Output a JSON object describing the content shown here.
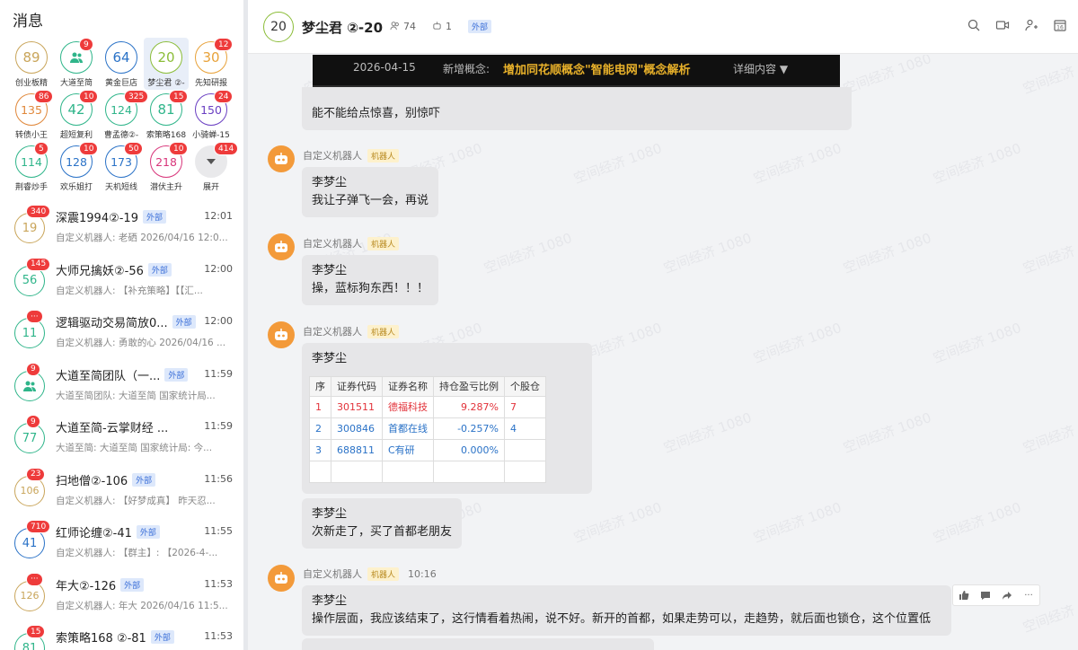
{
  "sidebar": {
    "title": "消息",
    "grid": [
      {
        "num": "89",
        "label": "创业板精",
        "badge": "",
        "color": "#c9a55a",
        "selected": false
      },
      {
        "num": "",
        "label": "大道至简",
        "badge": "9",
        "color": "#2fb58a",
        "selected": false,
        "icon": "people-icon"
      },
      {
        "num": "64",
        "label": "黄金巨店",
        "badge": "",
        "color": "#2a72c7",
        "selected": false
      },
      {
        "num": "20",
        "label": "梦尘君 ②-",
        "badge": "",
        "color": "#8bbd38",
        "selected": true
      },
      {
        "num": "30",
        "label": "先知研报",
        "badge": "12",
        "color": "#e8a23a",
        "selected": false
      },
      {
        "num": "135",
        "label": "转债小王",
        "badge": "86",
        "color": "#e0873a",
        "selected": false
      },
      {
        "num": "42",
        "label": "超短复利",
        "badge": "10",
        "color": "#2fb58a",
        "selected": false
      },
      {
        "num": "124",
        "label": "曹孟德②-",
        "badge": "325",
        "color": "#2fb58a",
        "selected": false
      },
      {
        "num": "81",
        "label": "索策略168",
        "badge": "15",
        "color": "#2fb58a",
        "selected": false
      },
      {
        "num": "150",
        "label": "小骑蝉-15",
        "badge": "24",
        "color": "#6a3fc2",
        "selected": false
      },
      {
        "num": "114",
        "label": "荆睿炒手",
        "badge": "5",
        "color": "#2fb58a",
        "selected": false
      },
      {
        "num": "128",
        "label": "欢乐姐打",
        "badge": "10",
        "color": "#2a72c7",
        "selected": false
      },
      {
        "num": "173",
        "label": "天机短线",
        "badge": "50",
        "color": "#2a72c7",
        "selected": false
      },
      {
        "num": "218",
        "label": "潜伏主升",
        "badge": "10",
        "color": "#d8357a",
        "selected": false
      },
      {
        "num": "",
        "label": "展开",
        "badge": "414",
        "color": "#e5e5e5",
        "selected": false,
        "icon": "expand-down-icon"
      }
    ],
    "conversations": [
      {
        "avatar": "19",
        "color": "#c9a55a",
        "badge": "340",
        "name": "深震1994②-19",
        "ext": "外部",
        "time": "12:01",
        "preview": "自定义机器人: 老硒 2026/04/16 12:0..."
      },
      {
        "avatar": "56",
        "color": "#2fb58a",
        "badge": "145",
        "name": "大师兄擒妖②-56",
        "ext": "外部",
        "time": "12:00",
        "preview": "自定义机器人: 【补充策略】【【汇..."
      },
      {
        "avatar": "11",
        "color": "#2fb58a",
        "badge": "···",
        "name": "逻辑驱动交易简放0...",
        "ext": "外部",
        "time": "12:00",
        "preview": "自定义机器人: 勇敢的心 2026/04/16 ..."
      },
      {
        "avatar": "",
        "color": "#2fb58a",
        "badge": "9",
        "name": "大道至简团队（一...",
        "ext": "外部",
        "time": "11:59",
        "preview": "大道至简团队: 大道至简 国家统计局...",
        "icon": "people-icon"
      },
      {
        "avatar": "77",
        "color": "#2fb58a",
        "badge": "9",
        "name": "大道至简-云掌财经 ...",
        "ext": "",
        "time": "11:59",
        "preview": "大道至简: 大道至简 国家统计局: 今..."
      },
      {
        "avatar": "106",
        "color": "#c9a55a",
        "badge": "23",
        "name": "扫地僧②-106",
        "ext": "外部",
        "time": "11:56",
        "preview": "自定义机器人: 【好梦成真】 昨天忍..."
      },
      {
        "avatar": "41",
        "color": "#2a72c7",
        "badge": "710",
        "name": "红师论缠②-41",
        "ext": "外部",
        "time": "11:55",
        "preview": "自定义机器人: 【群主】: 【2026-4-..."
      },
      {
        "avatar": "126",
        "color": "#c9a55a",
        "badge": "···",
        "name": "年大②-126",
        "ext": "外部",
        "time": "11:53",
        "preview": "自定义机器人: 年大 2026/04/16 11:5..."
      },
      {
        "avatar": "81",
        "color": "#2fb58a",
        "badge": "15",
        "name": "索策略168 ②-81",
        "ext": "外部",
        "time": "11:53",
        "preview": ""
      }
    ]
  },
  "header": {
    "avatar": "20",
    "title": "梦尘君 ②-20",
    "members": "74",
    "bots": "1",
    "ext": "外部"
  },
  "chat": {
    "watermark": "空间经济 1080",
    "banner": {
      "date": "2026-04-15",
      "label": "新增概念:",
      "title": "增加同花顺概念\"智能电网\"概念解析",
      "more": "详细内容 ▼"
    },
    "msg0_text": "能不能给点惊喜，别惊吓",
    "bot_name": "自定义机器人",
    "bot_tag": "机器人",
    "msg1": {
      "sender": "李梦尘",
      "text": "我让子弹飞一会，再说"
    },
    "msg2": {
      "sender": "李梦尘",
      "text": "操，蓝标狗东西！！！"
    },
    "msg3": {
      "sender": "李梦尘"
    },
    "table": {
      "headers": [
        "序",
        "证券代码",
        "证券名称",
        "持仓盈亏比例",
        "个股仓"
      ],
      "rows": [
        {
          "idx": "1",
          "code": "301511",
          "name": "德福科技",
          "pct": "9.287%",
          "pos": "7",
          "cls": "red"
        },
        {
          "idx": "2",
          "code": "300846",
          "name": "首都在线",
          "pct": "-0.257%",
          "pos": "4",
          "cls": "blue"
        },
        {
          "idx": "3",
          "code": "688811",
          "name": "C有研",
          "pct": "0.000%",
          "pos": "",
          "cls": "blue"
        }
      ]
    },
    "msg4": {
      "sender": "李梦尘",
      "text": "次新走了，买了首都老朋友"
    },
    "msg5_time": "10:16",
    "msg5": {
      "sender": "李梦尘",
      "text": "操作层面，我应该结束了，这行情看着热闹，说不好。新开的首都，如果走势可以，走趋势，就后面也锁仓，这个位置低"
    }
  },
  "colors": {
    "accent": "#3b6fd8",
    "badge": "#ee3b3b",
    "bot": "#f39a3a"
  }
}
